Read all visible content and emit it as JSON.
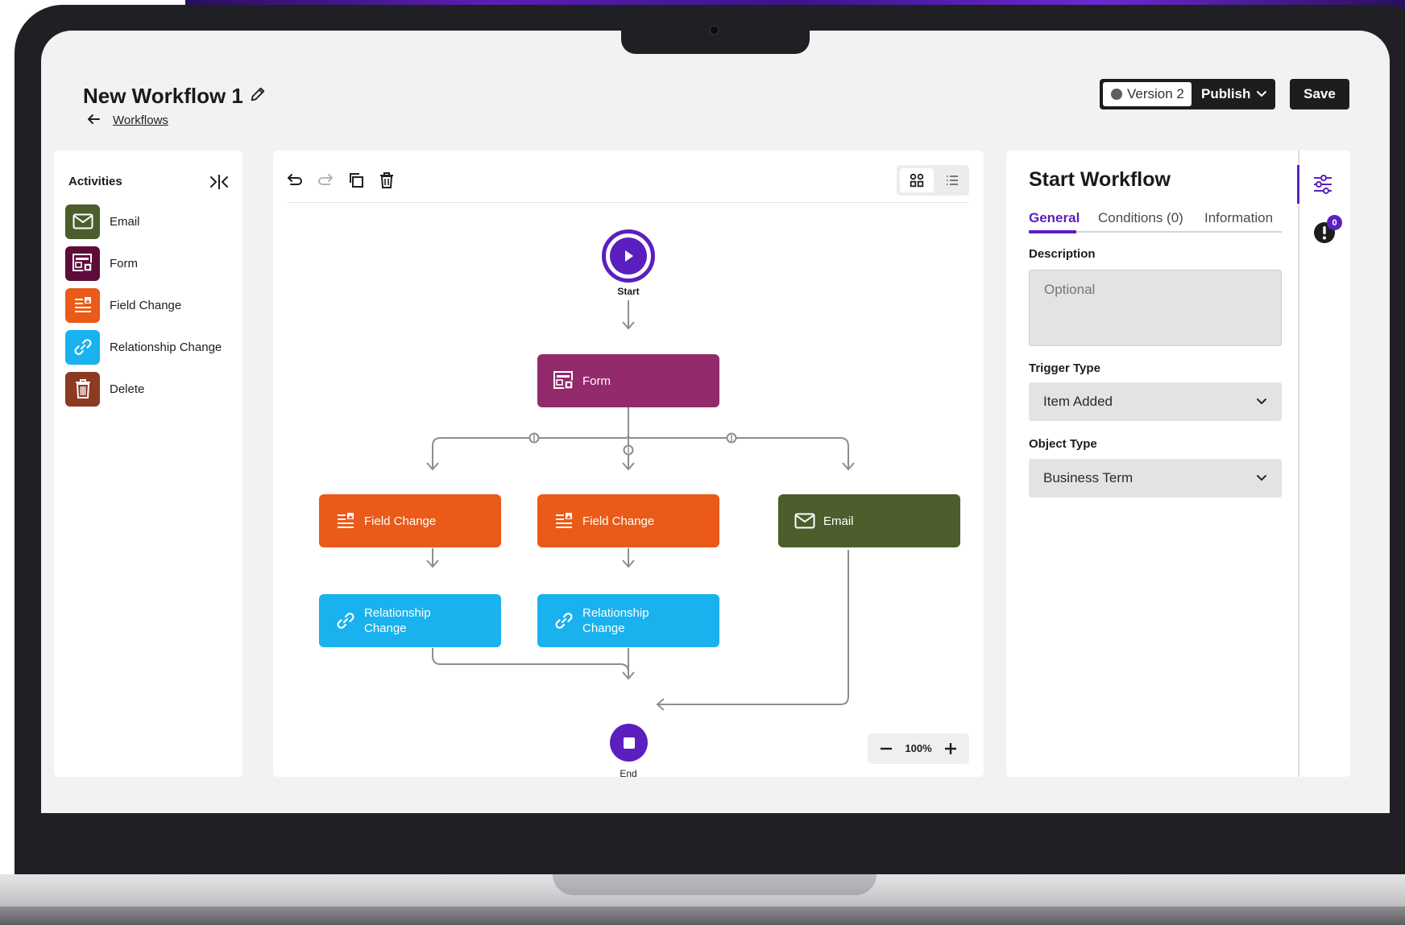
{
  "header": {
    "title": "New Workflow 1",
    "breadcrumb": "Workflows",
    "version_label": "Version 2",
    "publish_label": "Publish",
    "save_label": "Save"
  },
  "activities": {
    "title": "Activities",
    "items": [
      {
        "label": "Email",
        "color": "#4b5e2b",
        "icon": "envelope-icon"
      },
      {
        "label": "Form",
        "color": "#5e0d3a",
        "icon": "form-icon"
      },
      {
        "label": "Field Change",
        "color": "#ea5a19",
        "icon": "field-change-icon"
      },
      {
        "label": "Relationship Change",
        "color": "#19b2ee",
        "icon": "link-icon"
      },
      {
        "label": "Delete",
        "color": "#8c3a22",
        "icon": "trash-icon"
      }
    ]
  },
  "canvas": {
    "start_label": "Start",
    "end_label": "End",
    "zoom": "100%",
    "nodes": {
      "form": {
        "label": "Form",
        "color": "#932a6c"
      },
      "field_change_1": {
        "label": "Field Change",
        "color": "#ea5a19"
      },
      "field_change_2": {
        "label": "Field Change",
        "color": "#ea5a19"
      },
      "email": {
        "label": "Email",
        "color": "#4b5e2b"
      },
      "rel_change_1": {
        "label": "Relationship Change",
        "color": "#19b2ee"
      },
      "rel_change_2": {
        "label": "Relationship Change",
        "color": "#19b2ee"
      }
    }
  },
  "inspector": {
    "title": "Start Workflow",
    "tabs": [
      "General",
      "Conditions (0)",
      "Information"
    ],
    "description_label": "Description",
    "description_placeholder": "Optional",
    "trigger_label": "Trigger Type",
    "trigger_value": "Item Added",
    "object_label": "Object Type",
    "object_value": "Business Term",
    "alert_count": "0"
  },
  "colors": {
    "accent": "#5b1fbf",
    "dark_button": "#1d1d1f"
  }
}
